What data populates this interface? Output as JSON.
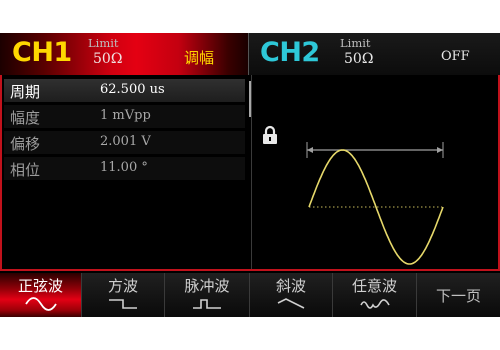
{
  "ch1": {
    "name": "CH1",
    "limit_label": "Limit",
    "impedance": "50Ω",
    "mode": "调幅"
  },
  "ch2": {
    "name": "CH2",
    "limit_label": "Limit",
    "impedance": "50Ω",
    "state": "OFF"
  },
  "params": [
    {
      "name": "周期",
      "value": "62.500 us",
      "selected": true
    },
    {
      "name": "幅度",
      "value": "1 mVpp",
      "selected": false
    },
    {
      "name": "偏移",
      "value": "2.001 V",
      "selected": false
    },
    {
      "name": "相位",
      "value": "11.00 °",
      "selected": false
    }
  ],
  "waveform": {
    "type": "sine",
    "color": "#e6d86a",
    "locked": true
  },
  "softkeys": [
    {
      "label": "正弦波",
      "icon": "sine-wave-icon",
      "active": true
    },
    {
      "label": "方波",
      "icon": "square-wave-icon",
      "active": false
    },
    {
      "label": "脉冲波",
      "icon": "pulse-wave-icon",
      "active": false
    },
    {
      "label": "斜波",
      "icon": "ramp-wave-icon",
      "active": false
    },
    {
      "label": "任意波",
      "icon": "arbitrary-wave-icon",
      "active": false
    },
    {
      "label": "下一页",
      "icon": "",
      "active": false
    }
  ],
  "colors": {
    "accent": "#e30014",
    "ch1_label": "#ffd800",
    "ch2_label": "#2ec8d8",
    "border": "#c1121c"
  }
}
